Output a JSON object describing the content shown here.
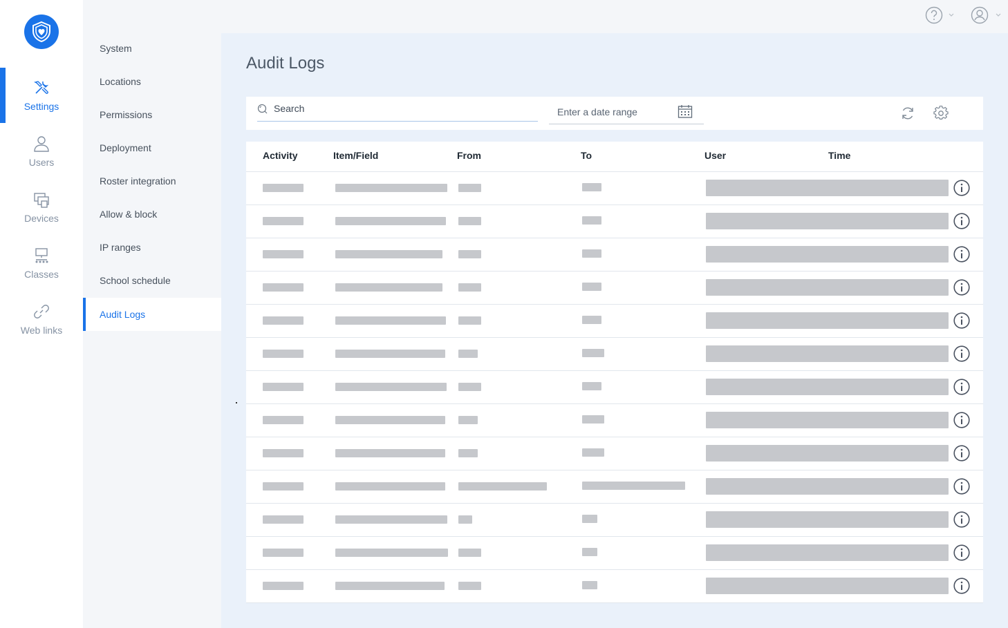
{
  "rail": {
    "items": [
      {
        "label": "Settings",
        "icon": "tools-icon",
        "active": true
      },
      {
        "label": "Users",
        "icon": "user-icon",
        "active": false
      },
      {
        "label": "Devices",
        "icon": "devices-icon",
        "active": false
      },
      {
        "label": "Classes",
        "icon": "classes-icon",
        "active": false
      },
      {
        "label": "Web links",
        "icon": "link-icon",
        "active": false
      }
    ]
  },
  "subnav": {
    "items": [
      {
        "label": "System",
        "active": false
      },
      {
        "label": "Locations",
        "active": false
      },
      {
        "label": "Permissions",
        "active": false
      },
      {
        "label": "Deployment",
        "active": false
      },
      {
        "label": "Roster integration",
        "active": false
      },
      {
        "label": "Allow & block",
        "active": false
      },
      {
        "label": "IP ranges",
        "active": false
      },
      {
        "label": "School schedule",
        "active": false
      },
      {
        "label": "Audit Logs",
        "active": true
      }
    ]
  },
  "topbar": {
    "help_icon": "help-icon",
    "account_icon": "account-icon"
  },
  "page": {
    "title": "Audit Logs"
  },
  "toolbar": {
    "search_placeholder": "Search",
    "date_placeholder": "Enter a date range",
    "refresh_icon": "refresh-icon",
    "settings_icon": "gear-icon"
  },
  "table": {
    "columns": [
      "Activity",
      "Item/Field",
      "From",
      "To",
      "User",
      "Time"
    ],
    "row_count": 13
  },
  "colors": {
    "accent": "#1a73e8",
    "placeholder": "#c6c8cc",
    "background": "#eaf1fa"
  }
}
